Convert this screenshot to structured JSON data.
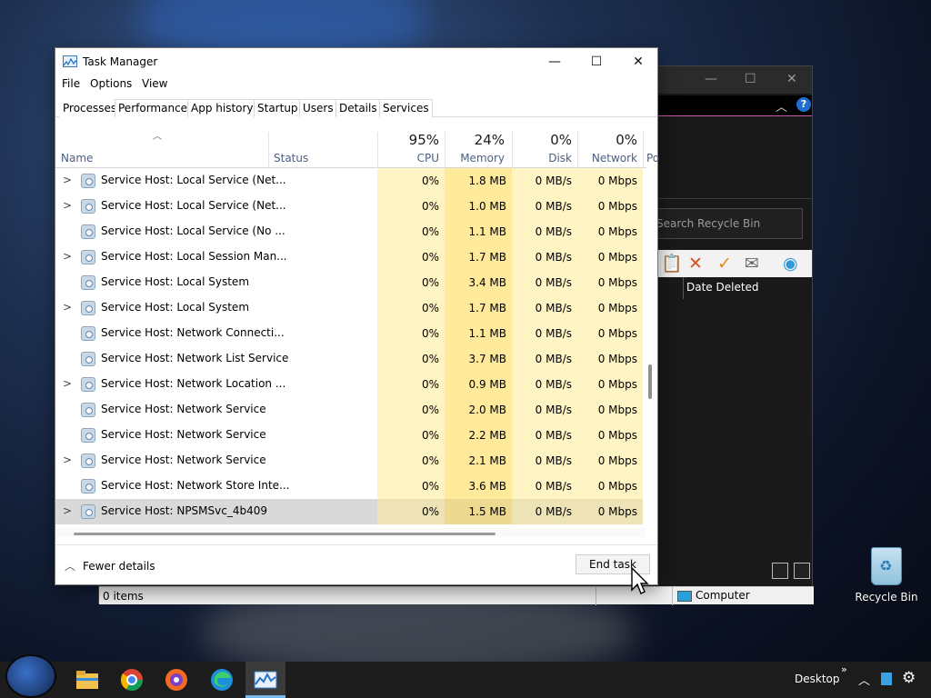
{
  "task_manager": {
    "title": "Task Manager",
    "menu": [
      "File",
      "Options",
      "View"
    ],
    "tabs": [
      "Processes",
      "Performance",
      "App history",
      "Startup",
      "Users",
      "Details",
      "Services"
    ],
    "active_tab": "Processes",
    "columns": {
      "name": "Name",
      "status": "Status",
      "cpu": {
        "pct": "95%",
        "label": "CPU"
      },
      "memory": {
        "pct": "24%",
        "label": "Memory"
      },
      "disk": {
        "pct": "0%",
        "label": "Disk"
      },
      "network": {
        "pct": "0%",
        "label": "Network"
      },
      "power_partial": "Po"
    },
    "rows": [
      {
        "name": "Service Host: Local Service (Net...",
        "expandable": true,
        "cpu": "0%",
        "memory": "1.8 MB",
        "disk": "0 MB/s",
        "network": "0 Mbps"
      },
      {
        "name": "Service Host: Local Service (Net...",
        "expandable": true,
        "cpu": "0%",
        "memory": "1.0 MB",
        "disk": "0 MB/s",
        "network": "0 Mbps"
      },
      {
        "name": "Service Host: Local Service (No ...",
        "expandable": false,
        "cpu": "0%",
        "memory": "1.1 MB",
        "disk": "0 MB/s",
        "network": "0 Mbps"
      },
      {
        "name": "Service Host: Local Session Man...",
        "expandable": true,
        "cpu": "0%",
        "memory": "1.7 MB",
        "disk": "0 MB/s",
        "network": "0 Mbps"
      },
      {
        "name": "Service Host: Local System",
        "expandable": false,
        "cpu": "0%",
        "memory": "3.4 MB",
        "disk": "0 MB/s",
        "network": "0 Mbps"
      },
      {
        "name": "Service Host: Local System",
        "expandable": true,
        "cpu": "0%",
        "memory": "1.7 MB",
        "disk": "0 MB/s",
        "network": "0 Mbps"
      },
      {
        "name": "Service Host: Network Connecti...",
        "expandable": false,
        "cpu": "0%",
        "memory": "1.1 MB",
        "disk": "0 MB/s",
        "network": "0 Mbps"
      },
      {
        "name": "Service Host: Network List Service",
        "expandable": false,
        "cpu": "0%",
        "memory": "3.7 MB",
        "disk": "0 MB/s",
        "network": "0 Mbps"
      },
      {
        "name": "Service Host: Network Location ...",
        "expandable": true,
        "cpu": "0%",
        "memory": "0.9 MB",
        "disk": "0 MB/s",
        "network": "0 Mbps"
      },
      {
        "name": "Service Host: Network Service",
        "expandable": false,
        "cpu": "0%",
        "memory": "2.0 MB",
        "disk": "0 MB/s",
        "network": "0 Mbps"
      },
      {
        "name": "Service Host: Network Service",
        "expandable": false,
        "cpu": "0%",
        "memory": "2.2 MB",
        "disk": "0 MB/s",
        "network": "0 Mbps"
      },
      {
        "name": "Service Host: Network Service",
        "expandable": true,
        "cpu": "0%",
        "memory": "2.1 MB",
        "disk": "0 MB/s",
        "network": "0 Mbps"
      },
      {
        "name": "Service Host: Network Store Inte...",
        "expandable": false,
        "cpu": "0%",
        "memory": "3.6 MB",
        "disk": "0 MB/s",
        "network": "0 Mbps"
      },
      {
        "name": "Service Host: NPSMSvc_4b409",
        "expandable": true,
        "cpu": "0%",
        "memory": "1.5 MB",
        "disk": "0 MB/s",
        "network": "0 Mbps",
        "selected": true
      }
    ],
    "footer": {
      "fewer_details": "Fewer details",
      "end_task": "End task"
    }
  },
  "explorer_bg": {
    "search_placeholder": "Search Recycle Bin",
    "date_deleted": "Date Deleted",
    "status_items": "0 items",
    "status_location": "Computer"
  },
  "desktop": {
    "recycle_bin": "Recycle Bin"
  },
  "taskbar": {
    "desktop_label": "Desktop"
  },
  "colors": {
    "cpu_column": "#fff4c4",
    "memory_column": "#ffe99a",
    "selected_row": "#d9d9d9",
    "help_blue": "#1e6fd0"
  }
}
